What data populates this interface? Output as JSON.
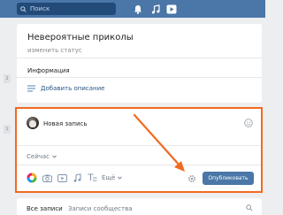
{
  "header": {
    "search_placeholder": "Поиск",
    "icons": [
      "bell-icon",
      "music-icon",
      "video-play-icon"
    ]
  },
  "side_numbers": [
    "2",
    "1"
  ],
  "profile": {
    "name": "Невероятные приколы",
    "status": "изменить статус",
    "info_label": "Информация",
    "add_description": "Добавить описание"
  },
  "composer": {
    "new_post": "Новая запись",
    "when": "Сейчас",
    "more": "Ещё",
    "publish": "Опубликовать"
  },
  "tabs": {
    "all_posts": "Все записи",
    "community_posts": "Записи сообщества"
  },
  "colors": {
    "brand": "#4a76a8",
    "highlight": "#f26a21",
    "link": "#2a5885"
  }
}
